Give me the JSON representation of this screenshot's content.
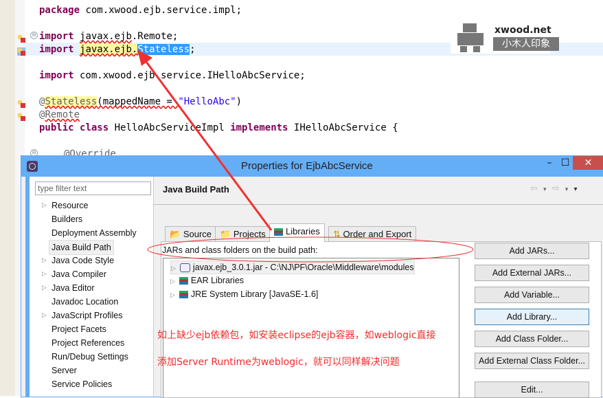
{
  "editor": {
    "lines": {
      "package": {
        "kw": "package",
        "rest": " com.xwood.ejb.service.impl;"
      },
      "import1": {
        "kw": "import",
        "pkg": "javax.ejb",
        "rest": ".Remote;"
      },
      "import2": {
        "kw": "import",
        "pkg_hl": "javax.ejb.",
        "sel": "Stateless",
        "end": ";"
      },
      "import3": {
        "kw": "import",
        "rest": " com.xwood.ejb.service.IHelloAbcService;"
      },
      "annot1": {
        "at": "@",
        "name": "Stateless",
        "open": "(mappedName = ",
        "str": "\"HelloAbc\"",
        "close": ")"
      },
      "annot2": {
        "at": "@",
        "name": "Remote"
      },
      "class_decl": {
        "kw1": "public",
        "kw2": "class",
        "name": " HelloAbcServiceImpl ",
        "kw3": "implements",
        "rest": " IHelloAbcService {"
      },
      "override": "@Override"
    },
    "fold_symbol": "⊖"
  },
  "watermark": {
    "brand": "xwood.net",
    "subtitle": "小木人印象"
  },
  "dialog": {
    "title": "Properties for EjbAbcService",
    "window_controls": {
      "minimize": "–",
      "maximize": "☐",
      "close": "✕"
    },
    "filter_placeholder": "type filter text",
    "nav_items": [
      {
        "label": "Resource",
        "expandable": true
      },
      {
        "label": "Builders",
        "expandable": false
      },
      {
        "label": "Deployment Assembly",
        "expandable": false
      },
      {
        "label": "Java Build Path",
        "expandable": false,
        "selected": true
      },
      {
        "label": "Java Code Style",
        "expandable": true
      },
      {
        "label": "Java Compiler",
        "expandable": true
      },
      {
        "label": "Java Editor",
        "expandable": true
      },
      {
        "label": "Javadoc Location",
        "expandable": false
      },
      {
        "label": "JavaScript Profiles",
        "expandable": true
      },
      {
        "label": "Project Facets",
        "expandable": false
      },
      {
        "label": "Project References",
        "expandable": false
      },
      {
        "label": "Run/Debug Settings",
        "expandable": false
      },
      {
        "label": "Server",
        "expandable": false
      },
      {
        "label": "Service Policies",
        "expandable": false
      }
    ],
    "page_title": "Java Build Path",
    "nav_tools": {
      "back": "⇦",
      "forward": "⇨",
      "dropdown": "▾",
      "menu": "▾"
    },
    "tabs": [
      {
        "label": "Source",
        "icon": "source-folder-icon"
      },
      {
        "label": "Projects",
        "icon": "projects-folder-icon"
      },
      {
        "label": "Libraries",
        "icon": "libraries-icon",
        "active": true
      },
      {
        "label": "Order and Export",
        "icon": "order-export-icon"
      }
    ],
    "panel_label": "JARs and class folders on the build path:",
    "libraries": [
      {
        "label": "javax.ejb_3.0.1.jar - C:\\NJ\\PF\\Oracle\\Middleware\\modules",
        "icon": "jar-icon",
        "selected": true
      },
      {
        "label": "EAR Libraries",
        "icon": "library-icon"
      },
      {
        "label": "JRE System Library [JavaSE-1.6]",
        "icon": "library-icon"
      }
    ],
    "buttons": [
      "Add JARs...",
      "Add External JARs...",
      "Add Variable...",
      "Add Library...",
      "Add Class Folder...",
      "Add External Class Folder...",
      "Edit..."
    ]
  },
  "annotation": {
    "line1": "如上缺少ejb依赖包，如安装eclipse的ejb容器，如weblogic直接",
    "line2": "添加Server Runtime为weblogic，就可以同样解决问题",
    "color": "#f02c2c"
  }
}
